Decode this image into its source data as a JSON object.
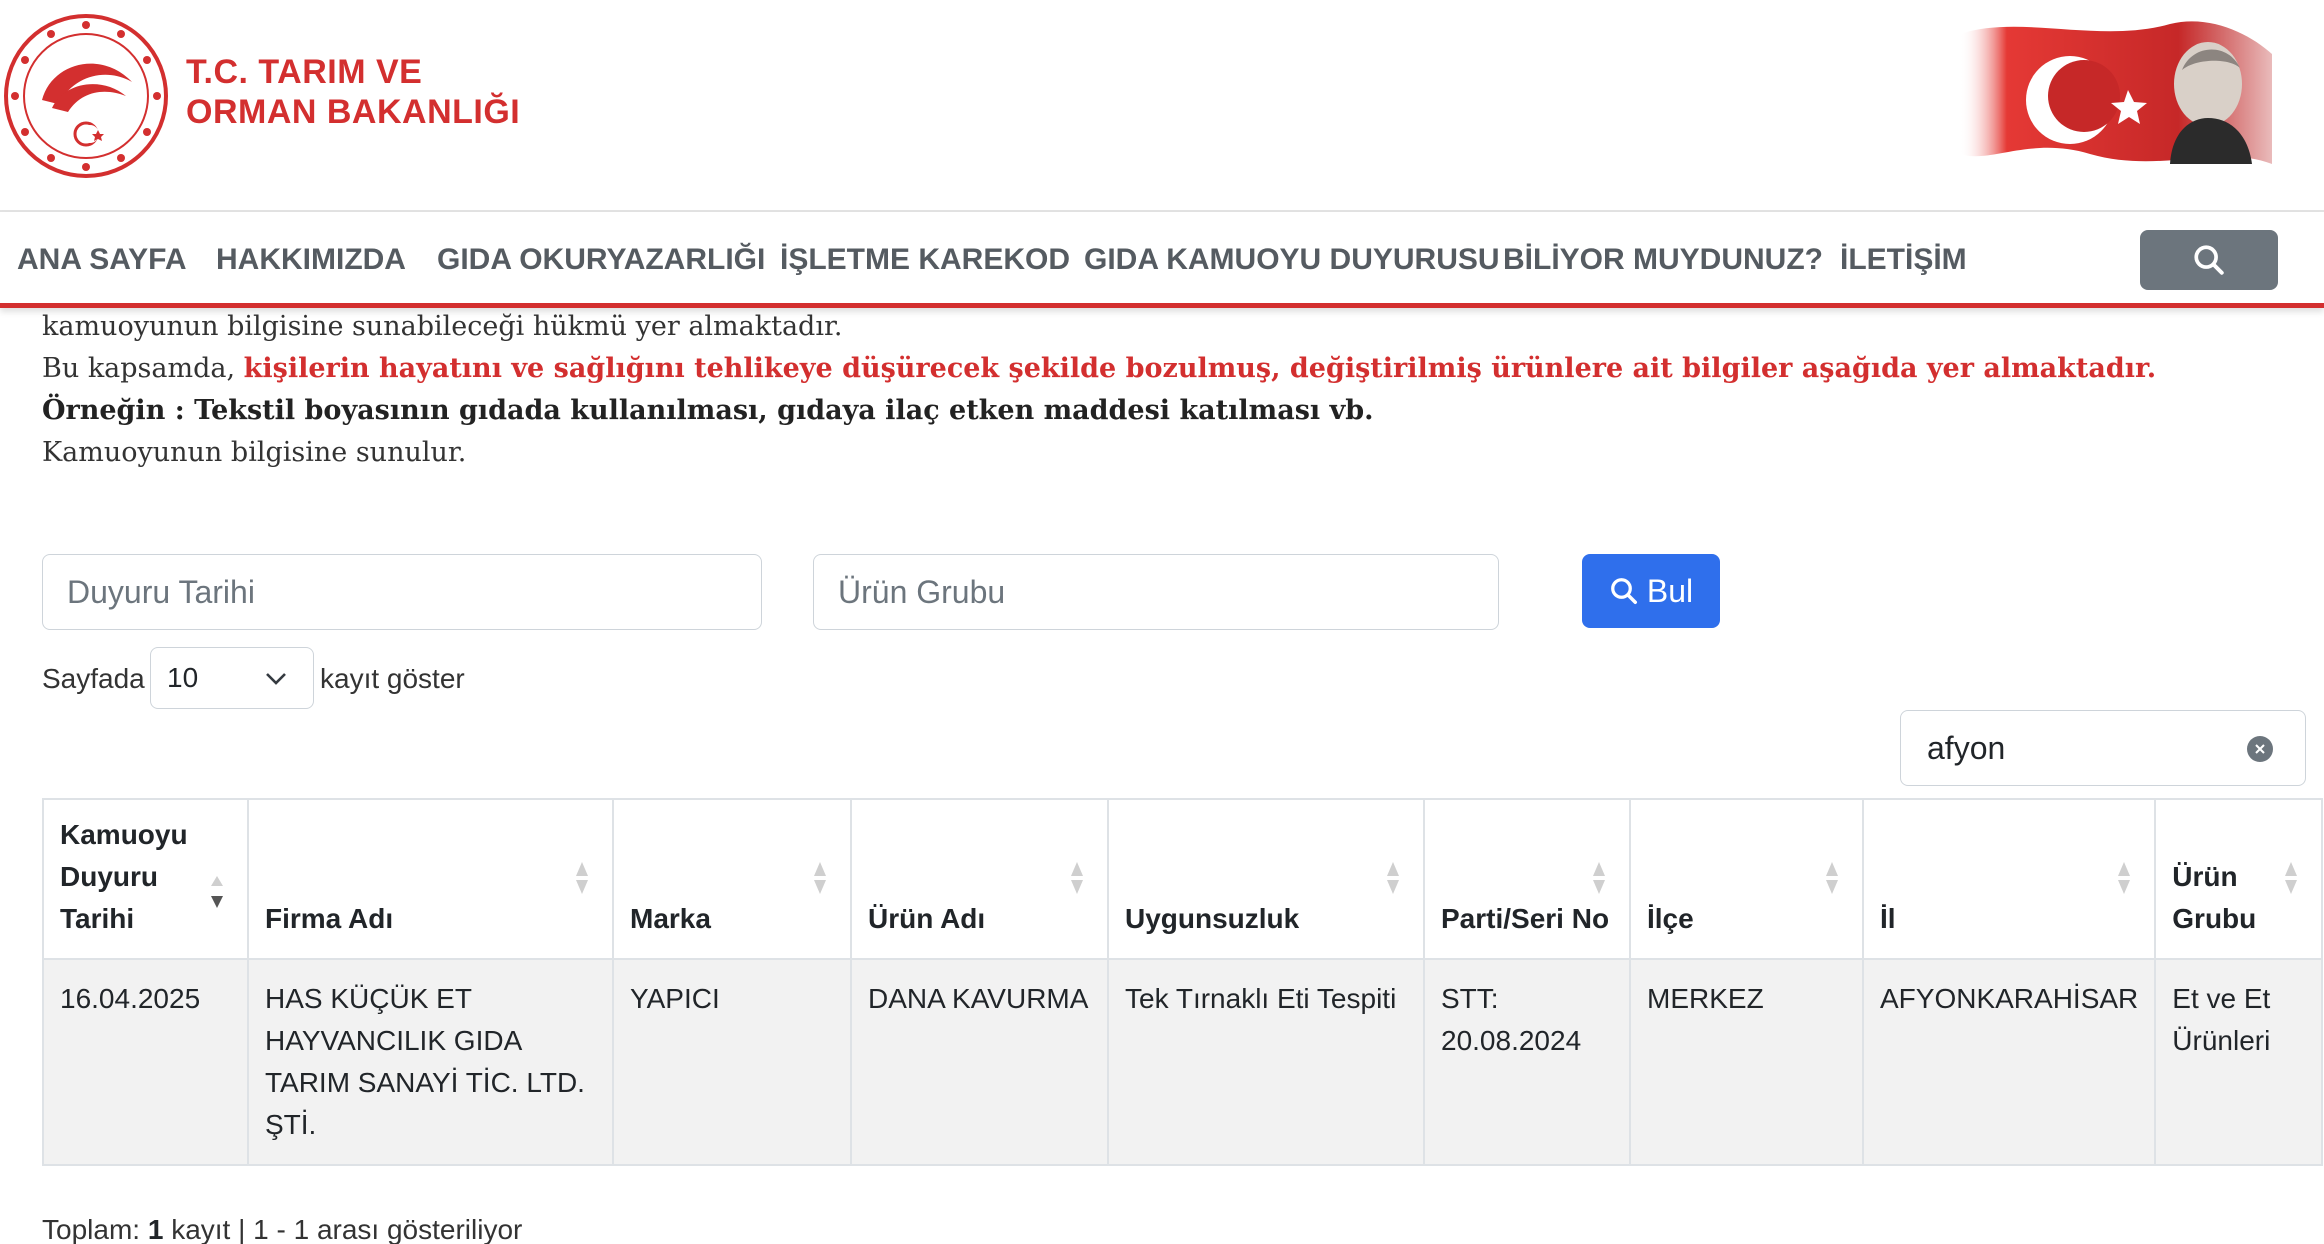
{
  "header": {
    "logo_line1": "T.C. TARIM VE",
    "logo_line2": "ORMAN BAKANLIĞI",
    "emblem_icon": "ministry-emblem-icon",
    "flag_icon": "turkish-flag-ataturk-banner",
    "accent_color": "#d32f2f"
  },
  "nav": {
    "items": [
      {
        "label": "ANA SAYFA"
      },
      {
        "label": "HAKKIMIZDA"
      },
      {
        "label": "GIDA OKURYAZARLIĞI"
      },
      {
        "label": "İŞLETME KAREKOD"
      },
      {
        "label": "GIDA KAMUOYU DUYURUSU"
      },
      {
        "label": "BİLİYOR MUYDUNUZ?"
      },
      {
        "label": "İLETİŞİM"
      }
    ],
    "search_icon": "search-icon"
  },
  "intro": {
    "line1": "kamuoyunun bilgisine sunabileceği hükmü yer almaktadır.",
    "line2_prefix": "Bu kapsamda, ",
    "line2_red": "kişilerin hayatını ve sağlığını tehlikeye düşürecek şekilde bozulmuş, değiştirilmiş ürünlere ait bilgiler aşağıda yer almaktadır.",
    "line3": "Örneğin : Tekstil boyasının gıdada kullanılması, gıdaya ilaç etken maddesi katılması vb.",
    "line4": "Kamuoyunun bilgisine sunulur."
  },
  "filters": {
    "date_placeholder": "Duyuru Tarihi",
    "group_placeholder": "Ürün Grubu",
    "find_button": "Bul",
    "find_color": "#2f6fec"
  },
  "length": {
    "prefix": "Sayfada",
    "value": "10",
    "suffix": "kayıt göster"
  },
  "search": {
    "value": "afyon"
  },
  "table": {
    "headers": [
      "Kamuoyu Duyuru Tarihi",
      "Firma Adı",
      "Marka",
      "Ürün Adı",
      "Uygunsuzluk",
      "Parti/Seri No",
      "İlçe",
      "İl",
      "Ürün Grubu"
    ],
    "rows": [
      [
        "16.04.2025",
        "HAS KÜÇÜK ET HAYVANCILIK GIDA TARIM SANAYİ TİC. LTD. ŞTİ.",
        "YAPICI",
        "DANA KAVURMA",
        "Tek Tırnaklı Eti Tespiti",
        "STT: 20.08.2024",
        "MERKEZ",
        "AFYONKARAHİSAR",
        "Et ve Et Ürünleri"
      ]
    ]
  },
  "summary": {
    "prefix": "Toplam:",
    "count": "1",
    "suffix": "kayıt | 1 - 1 arası gösteriliyor"
  }
}
